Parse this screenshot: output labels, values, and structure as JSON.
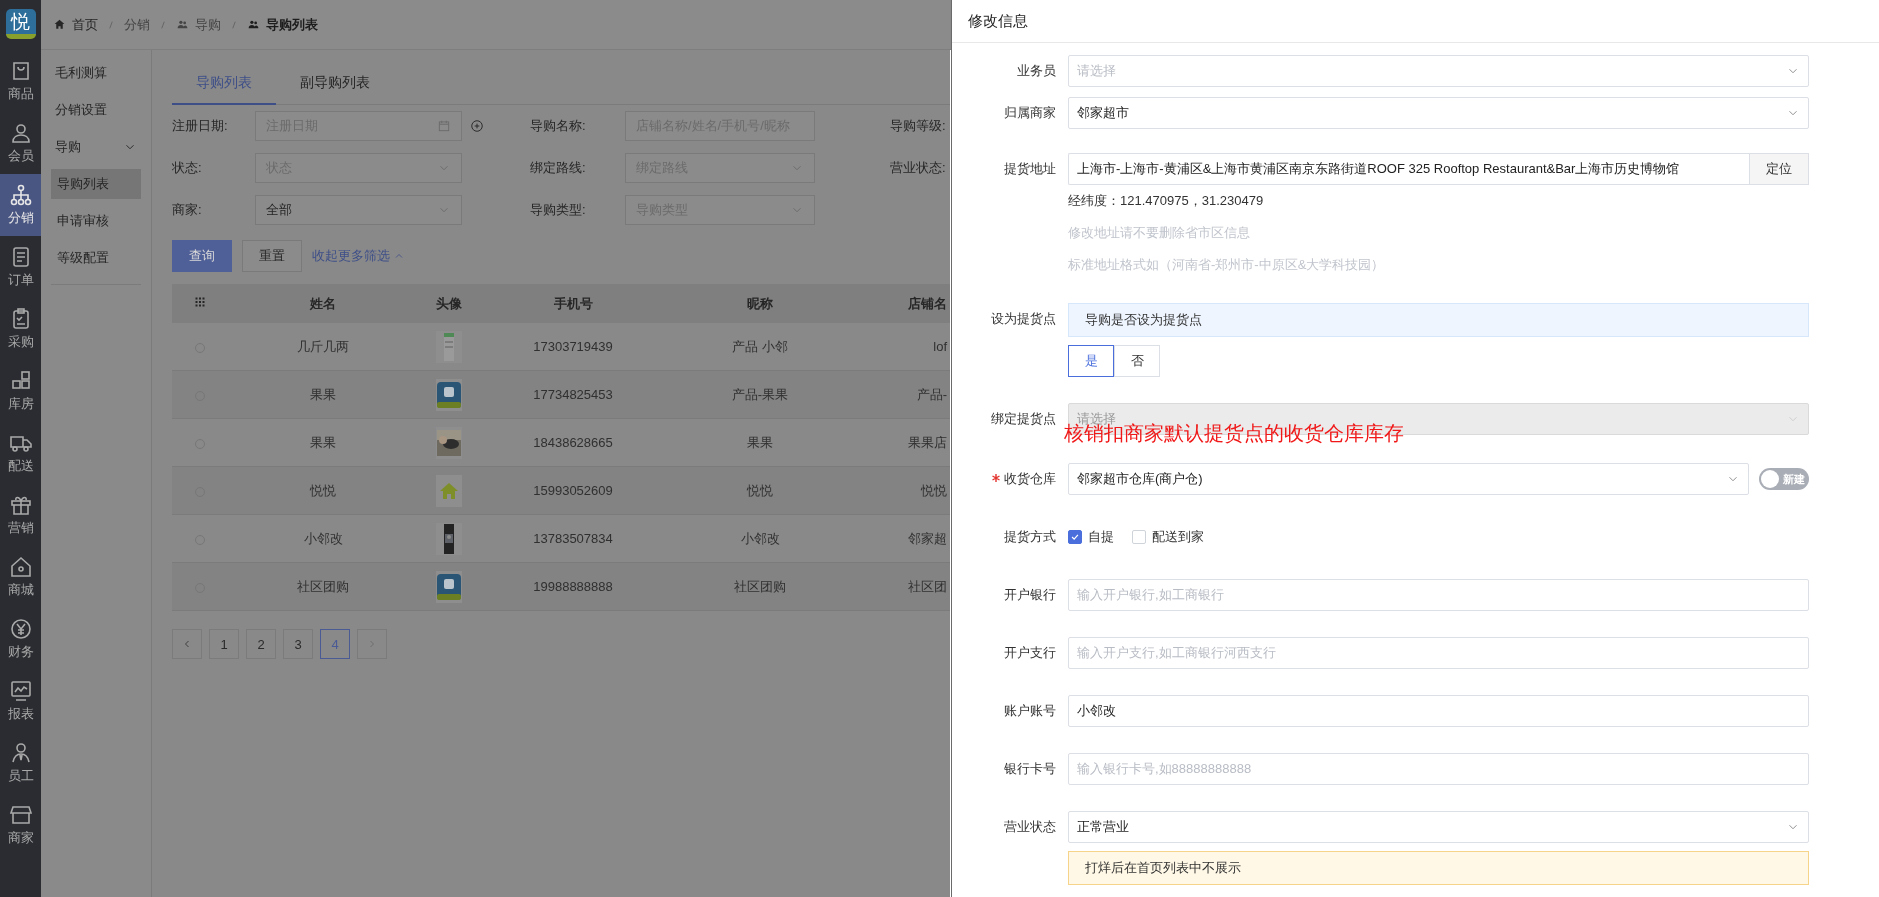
{
  "rail": {
    "logo": "悦",
    "items": [
      {
        "label": "商品",
        "selected": false
      },
      {
        "label": "会员",
        "selected": false
      },
      {
        "label": "分销",
        "selected": true
      },
      {
        "label": "订单",
        "selected": false
      },
      {
        "label": "采购",
        "selected": false
      },
      {
        "label": "库房",
        "selected": false
      },
      {
        "label": "配送",
        "selected": false
      },
      {
        "label": "营销",
        "selected": false
      },
      {
        "label": "商城",
        "selected": false
      },
      {
        "label": "财务",
        "selected": false
      },
      {
        "label": "报表",
        "selected": false
      },
      {
        "label": "员工",
        "selected": false
      },
      {
        "label": "商家",
        "selected": false
      }
    ]
  },
  "breadcrumb": [
    {
      "label": "首页"
    },
    {
      "label": "分销"
    },
    {
      "label": "导购"
    },
    {
      "label": "导购列表"
    }
  ],
  "submenu": {
    "items": [
      {
        "label": "毛利测算",
        "selected": false
      },
      {
        "label": "分销设置",
        "selected": false
      },
      {
        "label": "导购",
        "expanded": true,
        "children": [
          {
            "label": "导购列表",
            "selected": true
          },
          {
            "label": "申请审核",
            "selected": false
          },
          {
            "label": "等级配置",
            "selected": false
          }
        ]
      }
    ]
  },
  "tabs": [
    {
      "label": "导购列表",
      "selected": true
    },
    {
      "label": "副导购列表",
      "selected": false
    }
  ],
  "filters": [
    [
      {
        "label": "注册日期:",
        "kind": "date",
        "placeholder": "注册日期"
      },
      {
        "label": "导购名称:",
        "kind": "text",
        "placeholder": "店铺名称/姓名/手机号/昵称"
      },
      {
        "label": "导购等级:"
      }
    ],
    [
      {
        "label": "状态:",
        "kind": "select",
        "placeholder": "状态"
      },
      {
        "label": "绑定路线:",
        "kind": "select",
        "placeholder": "绑定路线"
      },
      {
        "label": "营业状态:"
      }
    ],
    [
      {
        "label": "商家:",
        "kind": "select",
        "value": "全部"
      },
      {
        "label": "导购类型:",
        "kind": "select",
        "placeholder": "导购类型"
      }
    ]
  ],
  "filter_buttons": [
    {
      "label": "查询",
      "kind": "primary"
    },
    {
      "label": "重置",
      "kind": "default"
    }
  ],
  "collapse_link": "收起更多筛选",
  "table": {
    "columns": [
      "姓名",
      "头像",
      "手机号",
      "昵称",
      "店铺名"
    ],
    "rows": [
      {
        "selected": false,
        "name": "几斤几两",
        "phone": "17303719439",
        "nickname": "产品 小邻",
        "store": "lof"
      },
      {
        "selected": false,
        "name": "果果",
        "phone": "17734825453",
        "nickname": "产品-果果",
        "store": "产品-"
      },
      {
        "selected": false,
        "name": "果果",
        "phone": "18438628665",
        "nickname": "果果",
        "store": "果果店"
      },
      {
        "selected": false,
        "name": "悦悦",
        "phone": "15993052609",
        "nickname": "悦悦",
        "store": "悦悦"
      },
      {
        "selected": false,
        "name": "小邻改",
        "phone": "13783507834",
        "nickname": "小邻改",
        "store": "邻家超"
      },
      {
        "selected": false,
        "name": "社区团购",
        "phone": "19988888888",
        "nickname": "社区团购",
        "store": "社区团"
      }
    ]
  },
  "pagination": {
    "prev_disabled": false,
    "next_disabled": true,
    "pages": [
      {
        "label": "1",
        "selected": false
      },
      {
        "label": "2",
        "selected": false
      },
      {
        "label": "3",
        "selected": false
      },
      {
        "label": "4",
        "selected": true
      }
    ]
  },
  "drawer": {
    "title": "修改信息",
    "annotation": "核销扣商家默认提货点的收货仓库库存",
    "fields": [
      {
        "label": "业务员",
        "kind": "select",
        "placeholder": "请选择",
        "required": false,
        "disabled": false
      },
      {
        "label": "归属商家",
        "kind": "select",
        "value": "邻家超市",
        "required": false,
        "disabled": false
      },
      {
        "label": "提货地址",
        "kind": "address",
        "value": "上海市-上海市-黄浦区&上海市黄浦区南京东路街道ROOF 325 Rooftop Restaurant&Bar上海市历史博物馆",
        "button": "定位",
        "required": false,
        "disabled": false,
        "notes": [
          {
            "text": "经纬度：121.470975，31.230479",
            "muted": false
          },
          {
            "text": "修改地址请不要删除省市区信息",
            "muted": true
          },
          {
            "text": "标准地址格式如（河南省-郑州市-中原区&大学科技园）",
            "muted": true
          }
        ]
      },
      {
        "label": "设为提货点",
        "kind": "choice",
        "info": "导购是否设为提货点",
        "required": false,
        "options": [
          {
            "label": "是",
            "selected": true
          },
          {
            "label": "否",
            "selected": false
          }
        ]
      },
      {
        "label": "绑定提货点",
        "kind": "select",
        "placeholder": "请选择",
        "required": false,
        "disabled": true
      },
      {
        "label": "收货仓库",
        "kind": "select",
        "value": "邻家超市仓库(商户仓)",
        "required": true,
        "disabled": false,
        "switch": {
          "label": "新建",
          "on": false
        }
      },
      {
        "label": "提货方式",
        "kind": "checkboxes",
        "required": false,
        "options": [
          {
            "label": "自提",
            "checked": true
          },
          {
            "label": "配送到家",
            "checked": false
          }
        ]
      },
      {
        "label": "开户银行",
        "kind": "text",
        "placeholder": "输入开户银行,如工商银行",
        "required": false,
        "disabled": false
      },
      {
        "label": "开户支行",
        "kind": "text",
        "placeholder": "输入开户支行,如工商银行河西支行",
        "required": false,
        "disabled": false
      },
      {
        "label": "账户账号",
        "kind": "text",
        "value": "小邻改",
        "required": false,
        "disabled": false
      },
      {
        "label": "银行卡号",
        "kind": "text",
        "placeholder": "输入银行卡号,如88888888888",
        "required": false,
        "disabled": false
      },
      {
        "label": "营业状态",
        "kind": "select",
        "value": "正常营业",
        "warning": "打烊后在首页列表中不展示",
        "required": false,
        "disabled": false
      }
    ]
  }
}
